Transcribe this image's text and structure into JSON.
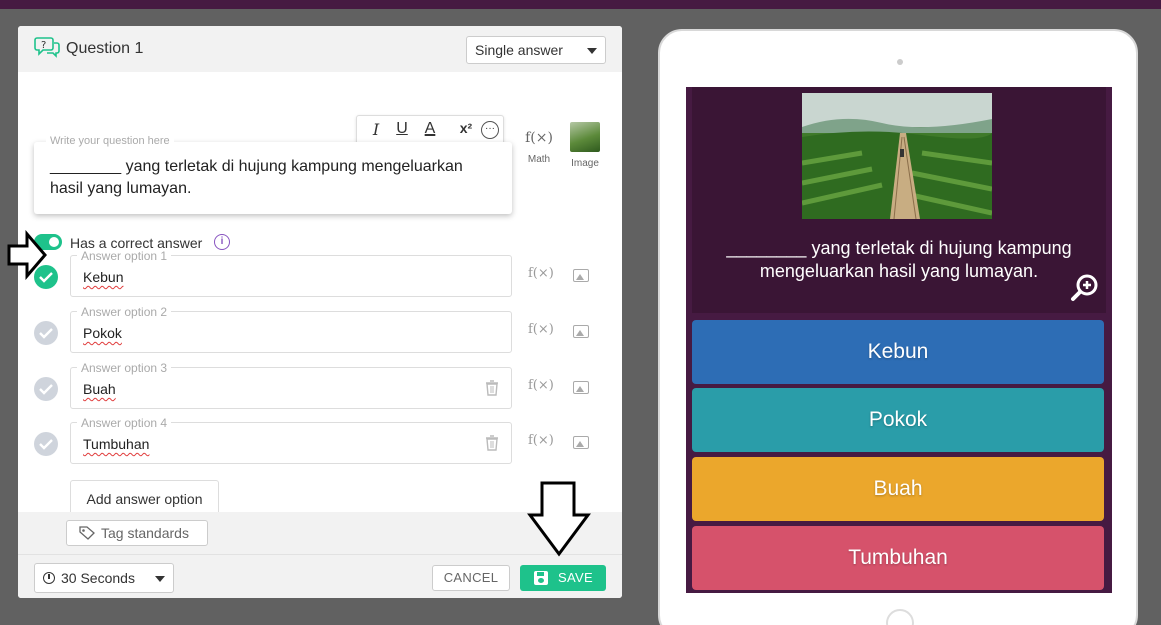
{
  "editor": {
    "title": "Question 1",
    "answer_type": "Single answer",
    "toolbar": {
      "italic": "I",
      "underline": "U",
      "color": "A",
      "superscript": "x²",
      "more": "···"
    },
    "question_placeholder": "Write your question here",
    "question_text": "________ yang terletak di hujung kampung mengeluarkan hasil yang lumayan.",
    "math_label": "Math",
    "image_label": "Image",
    "math_glyph": "f(×)",
    "correct_answer_label": "Has a correct answer",
    "info_glyph": "i",
    "answers": [
      {
        "label": "Answer option 1",
        "value": "Kebun"
      },
      {
        "label": "Answer option 2",
        "value": "Pokok"
      },
      {
        "label": "Answer option 3",
        "value": "Buah"
      },
      {
        "label": "Answer option 4",
        "value": "Tumbuhan"
      }
    ],
    "add_option": "Add answer option",
    "tag_standards": "Tag standards",
    "timer": "30 Seconds",
    "cancel": "CANCEL",
    "save": "SAVE"
  },
  "preview": {
    "question_text": "________ yang terletak di hujung kampung mengeluarkan hasil yang lumayan.",
    "options": [
      "Kebun",
      "Pokok",
      "Buah",
      "Tumbuhan"
    ]
  },
  "colors": {
    "brand_purple": "#461a42",
    "accent_green": "#1ec28b",
    "option_1": "#2d6db5",
    "option_2": "#2a9da9",
    "option_3": "#eba72c",
    "option_4": "#d6526b"
  }
}
